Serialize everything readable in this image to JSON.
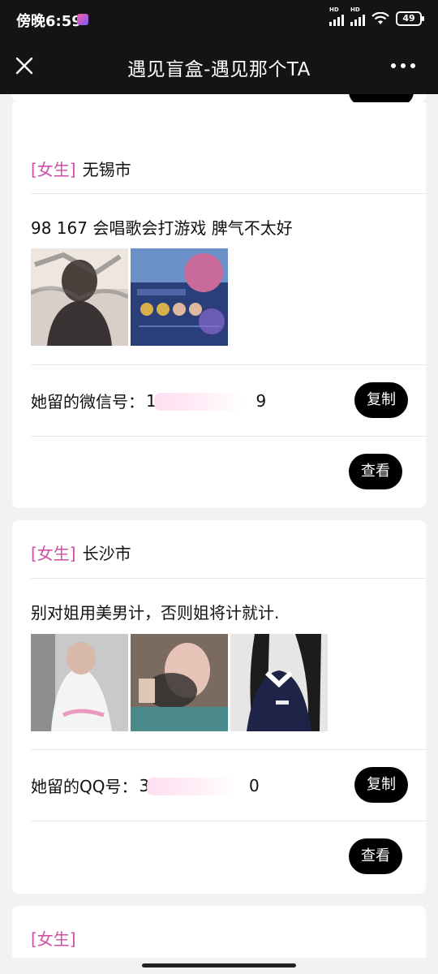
{
  "status_bar": {
    "time": "傍晚6:59",
    "network1": "HD",
    "network2": "HD",
    "battery": "49"
  },
  "header": {
    "title": "遇见盲盒-遇见那个TA"
  },
  "cards": [
    {
      "gender": "[女生]",
      "city": "无锡市",
      "description": "98 167 会唱歌会打游戏 脾气不太好",
      "contact_label": "她留的微信号：",
      "contact_visible_start": "1",
      "contact_visible_end": "9",
      "copy_label": "复制",
      "view_label": "查看"
    },
    {
      "gender": "[女生]",
      "city": "长沙市",
      "description": "别对姐用美男计，否则姐将计就计.",
      "contact_label": "她留的QQ号：",
      "contact_visible_start": "3",
      "contact_visible_end": "0",
      "copy_label": "复制",
      "view_label": "查看"
    },
    {
      "gender": "[女生]"
    }
  ]
}
